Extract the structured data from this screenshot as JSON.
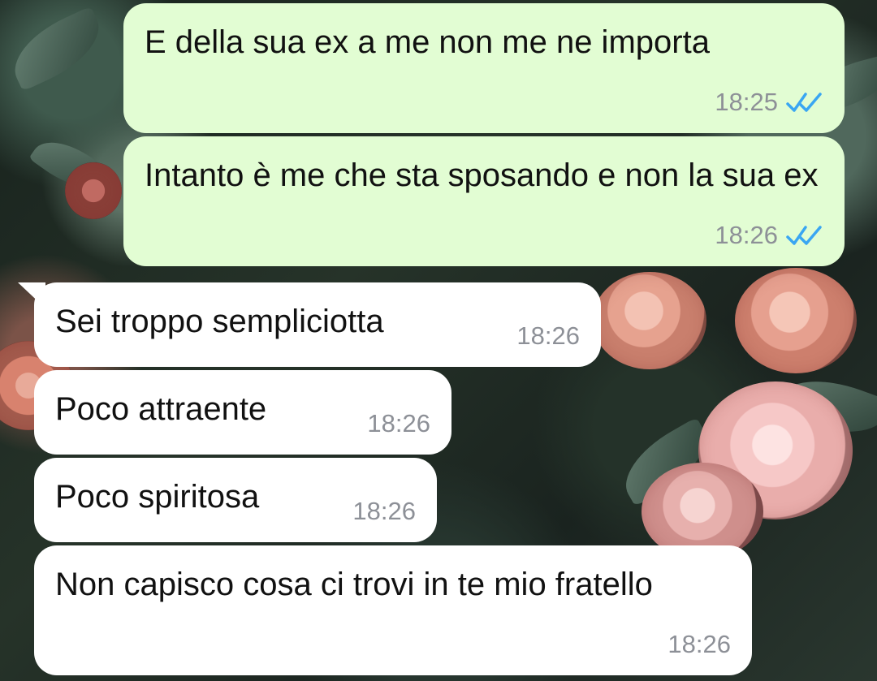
{
  "chat": {
    "messages": [
      {
        "direction": "outgoing",
        "text": "E della sua ex a me non me ne importa",
        "time": "18:25",
        "status_icon": "double-check-icon",
        "status_color": "#3aa6f2"
      },
      {
        "direction": "outgoing",
        "text": "Intanto è me che sta sposando e non la sua ex",
        "time": "18:26",
        "status_icon": "double-check-icon",
        "status_color": "#3aa6f2"
      },
      {
        "direction": "incoming",
        "text": "Sei troppo sempliciotta",
        "time": "18:26"
      },
      {
        "direction": "incoming",
        "text": "Poco attraente",
        "time": "18:26"
      },
      {
        "direction": "incoming",
        "text": "Poco spiritosa",
        "time": "18:26"
      },
      {
        "direction": "incoming",
        "text": "Non capisco cosa ci trovi in te mio fratello",
        "time": "18:26"
      }
    ]
  },
  "colors": {
    "outgoing_bubble": "#e2fdd3",
    "incoming_bubble": "#ffffff",
    "timestamp": "#8d9097"
  }
}
